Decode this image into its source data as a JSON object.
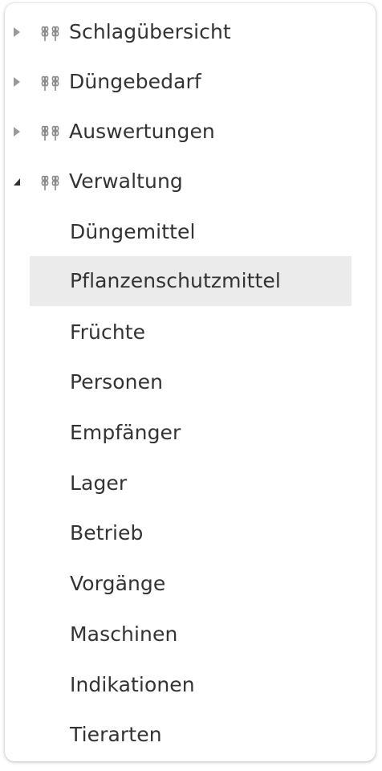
{
  "menu": {
    "top_items": [
      {
        "label": "Schlagübersicht",
        "icon": "wheat-icon",
        "expanded": false
      },
      {
        "label": "Düngebedarf",
        "icon": "wheat-icon",
        "expanded": false
      },
      {
        "label": "Auswertungen",
        "icon": "wheat-icon",
        "expanded": false
      },
      {
        "label": "Verwaltung",
        "icon": "wheat-icon",
        "expanded": true
      }
    ],
    "sub_items": [
      {
        "label": "Düngemittel",
        "selected": false
      },
      {
        "label": "Pflanzenschutzmittel",
        "selected": true
      },
      {
        "label": "Früchte",
        "selected": false
      },
      {
        "label": "Personen",
        "selected": false
      },
      {
        "label": "Empfänger",
        "selected": false
      },
      {
        "label": "Lager",
        "selected": false
      },
      {
        "label": "Betrieb",
        "selected": false
      },
      {
        "label": "Vorgänge",
        "selected": false
      },
      {
        "label": "Maschinen",
        "selected": false
      },
      {
        "label": "Indikationen",
        "selected": false
      },
      {
        "label": "Tierarten",
        "selected": false
      }
    ]
  },
  "colors": {
    "text": "#333333",
    "icon": "#8a8a8a",
    "selected_bg": "#ebebeb",
    "panel_bg": "#ffffff"
  }
}
